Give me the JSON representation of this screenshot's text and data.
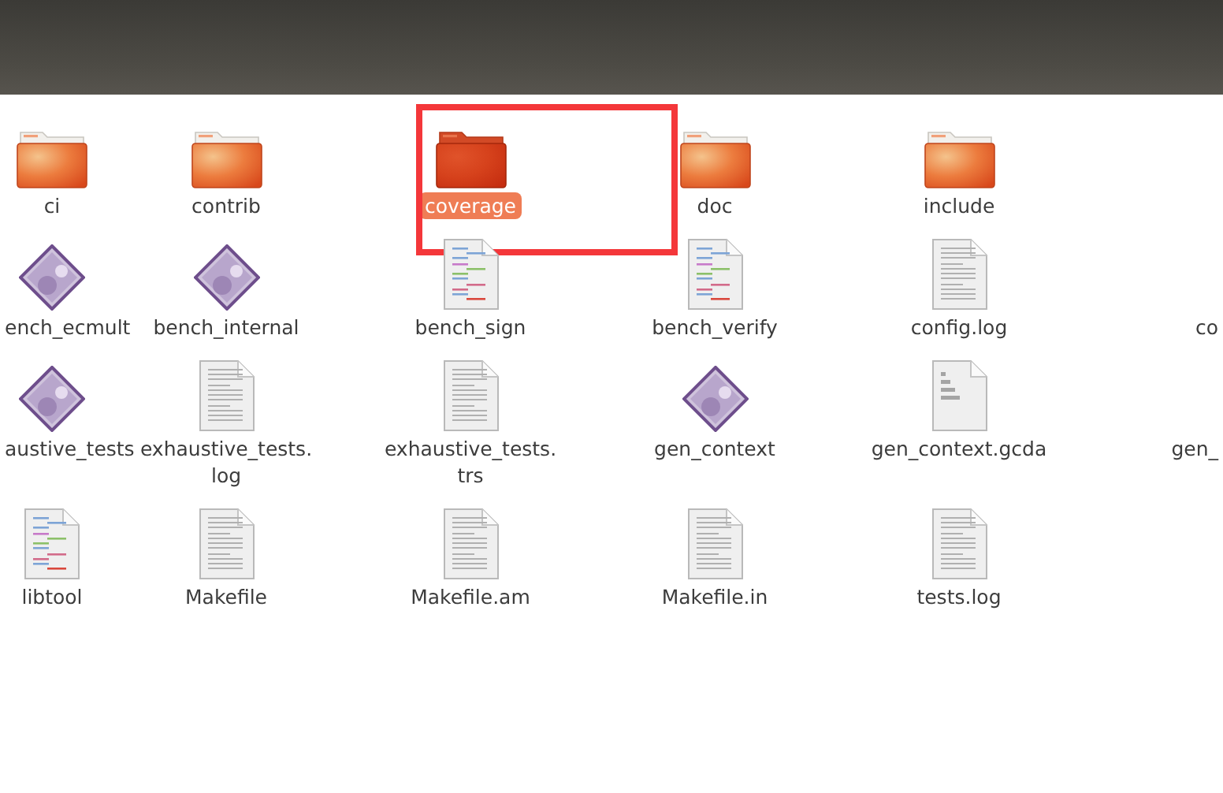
{
  "rows": [
    {
      "items": [
        {
          "name": "ci",
          "kind": "folder",
          "selected": false,
          "highlighted": false
        },
        {
          "name": "contrib",
          "kind": "folder",
          "selected": false,
          "highlighted": false
        },
        {
          "name": "coverage",
          "kind": "folder",
          "selected": true,
          "highlighted": true
        },
        {
          "name": "doc",
          "kind": "folder",
          "selected": false,
          "highlighted": false
        },
        {
          "name": "include",
          "kind": "folder",
          "selected": false,
          "highlighted": false
        }
      ]
    },
    {
      "items": [
        {
          "name": "ench_ecmult",
          "kind": "executable",
          "selected": false,
          "highlighted": false,
          "clipped_left": true
        },
        {
          "name": "bench_internal",
          "kind": "executable",
          "selected": false,
          "highlighted": false
        },
        {
          "name": "bench_sign",
          "kind": "code",
          "selected": false,
          "highlighted": false
        },
        {
          "name": "bench_verify",
          "kind": "code",
          "selected": false,
          "highlighted": false
        },
        {
          "name": "config.log",
          "kind": "text",
          "selected": false,
          "highlighted": false
        },
        {
          "name": "co",
          "kind": "none",
          "selected": false,
          "highlighted": false,
          "clipped_right": true
        }
      ]
    },
    {
      "items": [
        {
          "name": "austive_tests",
          "kind": "executable",
          "selected": false,
          "highlighted": false,
          "clipped_left": true
        },
        {
          "name": "exhaustive_tests.\nlog",
          "kind": "text",
          "selected": false,
          "highlighted": false
        },
        {
          "name": "exhaustive_tests.\ntrs",
          "kind": "text",
          "selected": false,
          "highlighted": false
        },
        {
          "name": "gen_context",
          "kind": "executable",
          "selected": false,
          "highlighted": false
        },
        {
          "name": "gen_context.gcda",
          "kind": "binary",
          "selected": false,
          "highlighted": false
        },
        {
          "name": "gen_",
          "kind": "none",
          "selected": false,
          "highlighted": false,
          "clipped_right": true
        }
      ]
    },
    {
      "items": [
        {
          "name": "libtool",
          "kind": "code",
          "selected": false,
          "highlighted": false
        },
        {
          "name": "Makefile",
          "kind": "text",
          "selected": false,
          "highlighted": false
        },
        {
          "name": "Makefile.am",
          "kind": "text",
          "selected": false,
          "highlighted": false
        },
        {
          "name": "Makefile.in",
          "kind": "text",
          "selected": false,
          "highlighted": false
        },
        {
          "name": "tests.log",
          "kind": "text",
          "selected": false,
          "highlighted": false
        }
      ]
    }
  ]
}
